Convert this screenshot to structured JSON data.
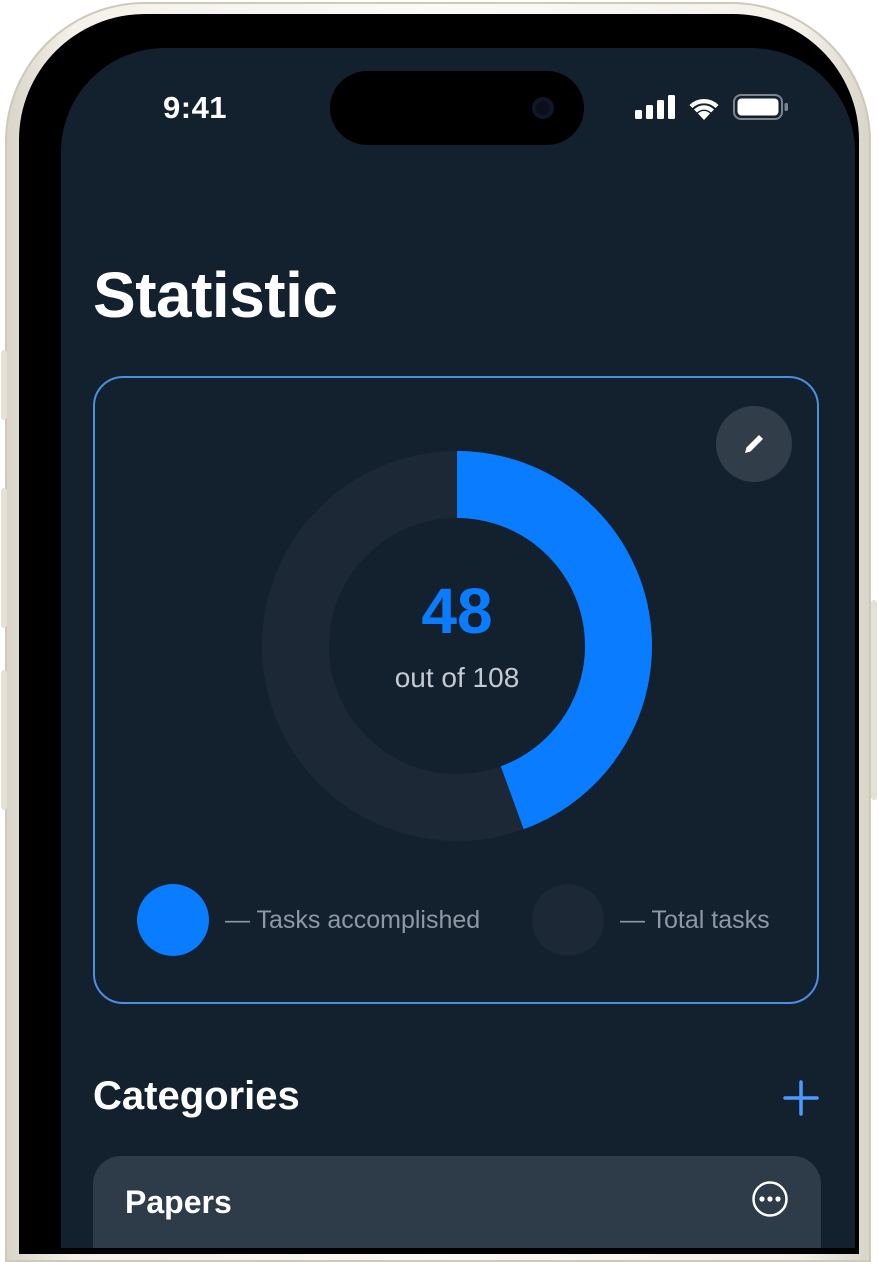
{
  "status_bar": {
    "time": "9:41"
  },
  "page": {
    "title": "Statistic"
  },
  "statistic_card": {
    "accomplished": 48,
    "total": 108,
    "center_value": "48",
    "center_subtitle": "out of 108",
    "legend": [
      {
        "label": "— Tasks accomplished",
        "color": "#0A7CFF"
      },
      {
        "label": "— Total tasks",
        "color": "#1C2836"
      }
    ],
    "edit_icon": "pencil-icon"
  },
  "categories": {
    "title": "Categories",
    "add_icon": "plus-icon",
    "items": [
      {
        "label": "Papers",
        "menu_icon": "ellipsis-circle-icon"
      }
    ]
  },
  "colors": {
    "background": "#13202E",
    "accent": "#0A7CFF",
    "card_border": "#4A8FE0",
    "track": "#1C2836"
  }
}
